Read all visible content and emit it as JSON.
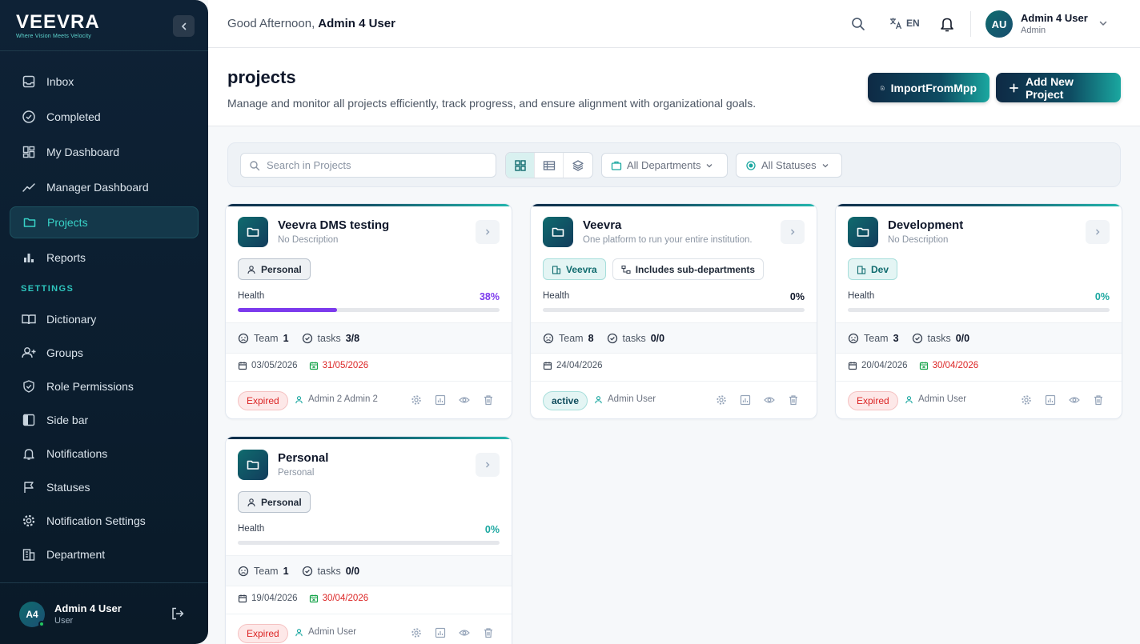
{
  "sidebar": {
    "brand": {
      "logo": "VEEVRA",
      "tagline": "Where Vision Meets Velocity"
    },
    "items": [
      {
        "label": "Inbox",
        "icon": "inbox-icon"
      },
      {
        "label": "Completed",
        "icon": "check-circle-icon"
      },
      {
        "label": "My Dashboard",
        "icon": "dashboard-icon"
      },
      {
        "label": "Manager Dashboard",
        "icon": "trend-icon"
      },
      {
        "label": "Projects",
        "icon": "folder-icon",
        "active": true
      },
      {
        "label": "Reports",
        "icon": "bar-chart-icon"
      }
    ],
    "settings_label": "SETTINGS",
    "settings_items": [
      {
        "label": "Dictionary",
        "icon": "book-icon"
      },
      {
        "label": "Groups",
        "icon": "user-plus-icon"
      },
      {
        "label": "Role Permissions",
        "icon": "shield-icon"
      },
      {
        "label": "Side bar",
        "icon": "sidebar-icon"
      },
      {
        "label": "Notifications",
        "icon": "bell-icon"
      },
      {
        "label": "Statuses",
        "icon": "flag-icon"
      },
      {
        "label": "Notification Settings",
        "icon": "gear-icon"
      },
      {
        "label": "Department",
        "icon": "building-icon"
      }
    ],
    "user": {
      "initials": "A4",
      "name": "Admin 4 User",
      "role": "User"
    }
  },
  "header": {
    "greeting": "Good Afternoon,",
    "greeting_name": "Admin 4 User",
    "language": "EN",
    "user": {
      "initials": "AU",
      "name": "Admin 4 User",
      "role": "Admin"
    }
  },
  "page": {
    "title": "projects",
    "subtitle": "Manage and monitor all projects efficiently, track progress, and ensure alignment with organizational goals.",
    "import_label": "ImportFromMpp",
    "add_label": "Add New Project"
  },
  "toolbar": {
    "search_placeholder": "Search in Projects",
    "department_filter": "All Departments",
    "status_filter": "All Statuses"
  },
  "labels": {
    "health": "Health",
    "team": "Team",
    "tasks": "tasks"
  },
  "colors": {
    "accent": "#1aa7a0",
    "navy": "#0e2a45",
    "expired": "#dc2626",
    "health_purple": "#7c3aed"
  },
  "projects": [
    {
      "title": "Veevra DMS testing",
      "description": "No Description",
      "tags": [
        {
          "label": "Personal",
          "kind": "personal"
        }
      ],
      "health_pct": "38%",
      "health_value": 0.38,
      "team": "1",
      "tasks": "3/8",
      "start_date": "03/05/2026",
      "end_date": "31/05/2026",
      "status": "Expired",
      "owner": "Admin 2 Admin 2"
    },
    {
      "title": "Veevra",
      "description": "One platform to run your entire institution.",
      "tags": [
        {
          "label": "Veevra",
          "kind": "dept"
        },
        {
          "label": "Includes sub-departments",
          "kind": "sub"
        }
      ],
      "health_pct": "0%",
      "health_value": 0,
      "team": "8",
      "tasks": "0/0",
      "start_date": "24/04/2026",
      "end_date": "",
      "status": "active",
      "owner": "Admin User"
    },
    {
      "title": "Development",
      "description": "No Description",
      "tags": [
        {
          "label": "Dev",
          "kind": "dept"
        }
      ],
      "health_pct": "0%",
      "health_value": 0,
      "team": "3",
      "tasks": "0/0",
      "start_date": "20/04/2026",
      "end_date": "30/04/2026",
      "status": "Expired",
      "owner": "Admin User"
    },
    {
      "title": "Personal",
      "description": "Personal",
      "tags": [
        {
          "label": "Personal",
          "kind": "personal"
        }
      ],
      "health_pct": "0%",
      "health_value": 0,
      "team": "1",
      "tasks": "0/0",
      "start_date": "19/04/2026",
      "end_date": "30/04/2026",
      "status": "Expired",
      "owner": "Admin User"
    }
  ]
}
